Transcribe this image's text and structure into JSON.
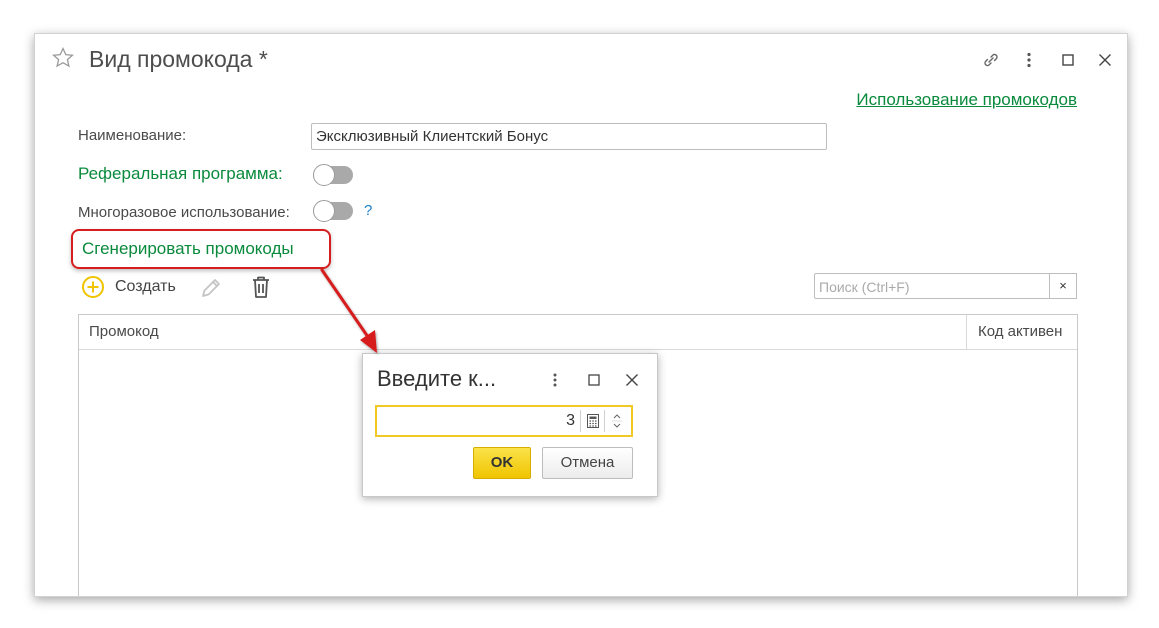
{
  "window": {
    "title": "Вид промокода *",
    "usage_link": "Использование промокодов"
  },
  "form": {
    "name_label": "Наименование:",
    "name_value": "Эксклюзивный Клиентский Бонус",
    "referral_label": "Реферальная программа:",
    "reusable_label": "Многоразовое использование:",
    "help_mark": "?",
    "generate_link": "Сгенерировать промокоды"
  },
  "toolbar": {
    "create_label": "Создать",
    "search_placeholder": "Поиск (Ctrl+F)",
    "search_clear": "×"
  },
  "table": {
    "columns": [
      "Промокод",
      "Код активен"
    ]
  },
  "dialog": {
    "title": "Введите к...",
    "value": "3",
    "ok_label": "OK",
    "cancel_label": "Отмена"
  },
  "colors": {
    "link_green": "#0a8a3c",
    "highlight_red": "#d61e1e",
    "ok_yellow": "#f0c400"
  }
}
